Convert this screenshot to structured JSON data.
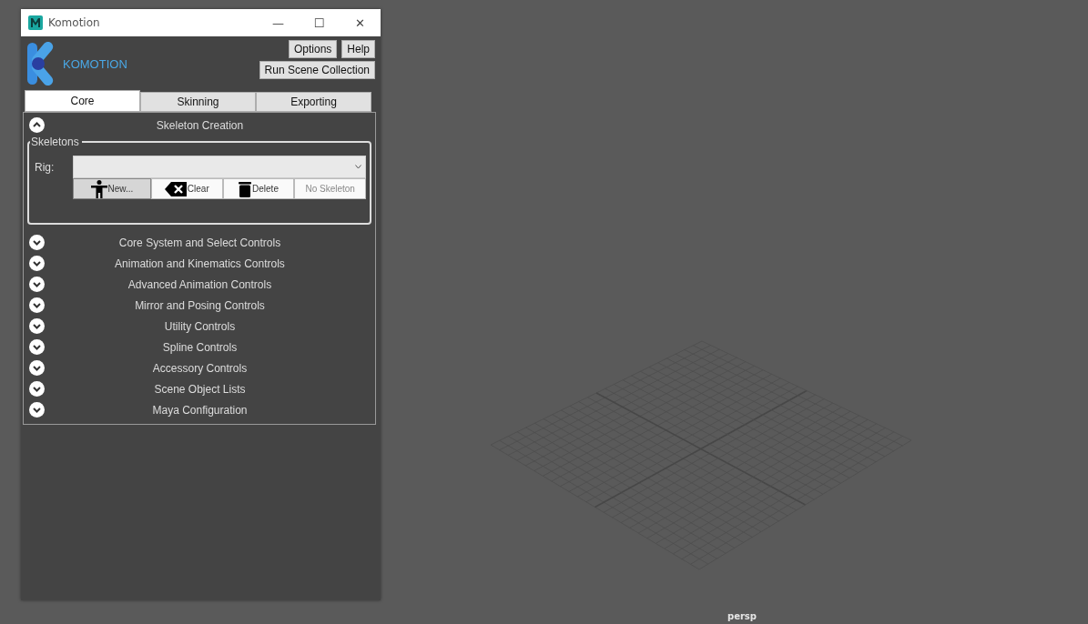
{
  "window": {
    "title": "Komotion",
    "controls": [
      "—",
      "☐",
      "✕"
    ]
  },
  "logo": {
    "text": "KOMOTION"
  },
  "header_buttons": [
    "Options",
    "Help",
    "Run Scene Collection"
  ],
  "tabs": [
    {
      "label": "Core",
      "selected": true
    },
    {
      "label": "Skinning",
      "selected": false
    },
    {
      "label": "Exporting",
      "selected": false
    }
  ],
  "sections": [
    {
      "title": "Skeleton Creation",
      "expanded": true,
      "group": {
        "title": "Skeletons",
        "rig_label": "Rig:",
        "buttons": [
          {
            "kind": "person",
            "label": "New...",
            "pressed": true,
            "disabled": false
          },
          {
            "kind": "clear",
            "label": "Clear",
            "pressed": false,
            "disabled": false
          },
          {
            "kind": "trash",
            "label": "Delete",
            "pressed": false,
            "disabled": false
          },
          {
            "kind": "text",
            "label": "No Skeleton",
            "pressed": false,
            "disabled": true
          }
        ]
      }
    },
    {
      "title": "Core System and Select Controls",
      "expanded": false
    },
    {
      "title": "Animation and Kinematics Controls",
      "expanded": false
    },
    {
      "title": "Advanced Animation Controls",
      "expanded": false
    },
    {
      "title": "Mirror and Posing Controls",
      "expanded": false
    },
    {
      "title": "Utility Controls",
      "expanded": false
    },
    {
      "title": "Spline Controls",
      "expanded": false
    },
    {
      "title": "Accessory Controls",
      "expanded": false
    },
    {
      "title": "Scene Object Lists",
      "expanded": false
    },
    {
      "title": "Maya Configuration",
      "expanded": false
    }
  ],
  "viewport": {
    "camera_label": "persp"
  }
}
